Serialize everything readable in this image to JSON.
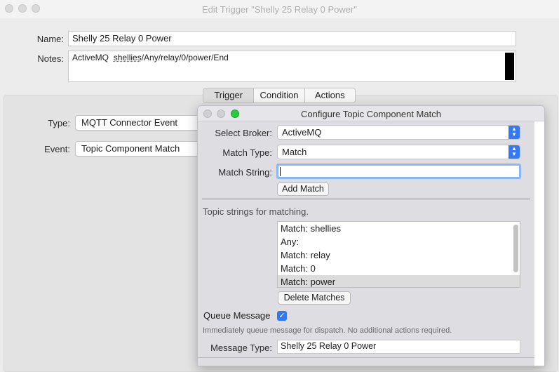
{
  "window": {
    "title": "Edit Trigger \"Shelly 25 Relay 0 Power\""
  },
  "form": {
    "name_label": "Name:",
    "name_value": "Shelly 25 Relay 0 Power",
    "notes_label": "Notes:",
    "notes_prefix": "ActiveMQ  ",
    "notes_spell": "shellies",
    "notes_rest": "/Any/relay/0/power/End"
  },
  "tabs": [
    "Trigger",
    "Condition",
    "Actions"
  ],
  "trigger": {
    "type_label": "Type:",
    "type_value": "MQTT Connector Event",
    "event_label": "Event:",
    "event_value": "Topic Component Match"
  },
  "sheet": {
    "title": "Configure Topic Component Match",
    "broker_label": "Select Broker:",
    "broker_value": "ActiveMQ",
    "match_type_label": "Match Type:",
    "match_type_value": "Match",
    "match_string_label": "Match String:",
    "match_string_value": "",
    "add_match_label": "Add Match",
    "topic_strings_label": "Topic strings for matching.",
    "matches": [
      "Match: shellies",
      "Any:",
      "Match: relay",
      "Match: 0",
      "Match: power"
    ],
    "selected_index": 4,
    "delete_matches_label": "Delete Matches",
    "queue_message_label": "Queue Message",
    "queue_message_checked": true,
    "queue_hint": "Immediately queue message for dispatch.  No additional actions required.",
    "message_type_label": "Message Type:",
    "message_type_value": "Shelly 25 Relay 0 Power"
  },
  "colors": {
    "accent": "#3478f6",
    "green_light": "#28c840"
  }
}
